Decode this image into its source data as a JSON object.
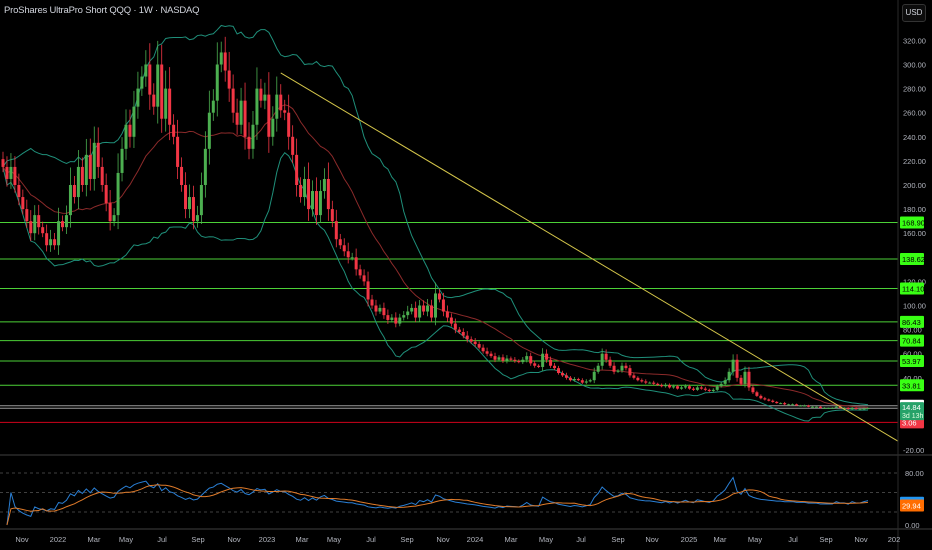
{
  "header": {
    "title": "ProShares UltraPro Short QQQ · 1W · NASDAQ",
    "currency": "USD"
  },
  "chart_data": {
    "type": "candlestick",
    "title": "ProShares UltraPro Short QQQ · 1W · NASDAQ",
    "interval": "1W",
    "price_axis": {
      "ticks": [
        "320.00",
        "300.00",
        "280.00",
        "260.00",
        "240.00",
        "220.00",
        "200.00",
        "180.00",
        "160.00",
        "120.00",
        "100.00",
        "80.00",
        "60.00",
        "40.00",
        "-20.00"
      ],
      "tick_values": [
        320,
        300,
        280,
        260,
        240,
        220,
        200,
        180,
        160,
        120,
        100,
        80,
        60,
        40,
        -20
      ],
      "range": [
        -25,
        350
      ]
    },
    "time_axis": {
      "ticks": [
        "Nov",
        "2022",
        "Mar",
        "May",
        "Jul",
        "Sep",
        "Nov",
        "2023",
        "Mar",
        "May",
        "Jul",
        "Sep",
        "Nov",
        "2024",
        "Mar",
        "May",
        "Jul",
        "Sep",
        "Nov",
        "2025",
        "Mar",
        "May",
        "Jul",
        "Sep",
        "Nov",
        "202"
      ]
    },
    "closes": [
      215,
      205,
      215,
      200,
      190,
      180,
      170,
      160,
      175,
      165,
      160,
      150,
      155,
      150,
      170,
      165,
      175,
      200,
      190,
      215,
      200,
      225,
      205,
      235,
      215,
      200,
      185,
      170,
      175,
      210,
      230,
      250,
      240,
      265,
      280,
      290,
      300,
      275,
      265,
      300,
      255,
      280,
      250,
      240,
      215,
      200,
      180,
      190,
      170,
      175,
      200,
      230,
      260,
      270,
      300,
      310,
      295,
      280,
      260,
      250,
      270,
      240,
      230,
      250,
      280,
      270,
      275,
      240,
      255,
      275,
      262,
      260,
      240,
      225,
      200,
      190,
      205,
      180,
      195,
      175,
      195,
      205,
      180,
      170,
      155,
      150,
      145,
      140,
      140,
      130,
      125,
      120,
      105,
      100,
      95,
      98,
      92,
      88,
      90,
      85,
      90,
      92,
      95,
      98,
      90,
      100,
      95,
      100,
      90,
      110,
      105,
      95,
      90,
      85,
      80,
      78,
      75,
      72,
      70,
      68,
      65,
      62,
      60,
      58,
      55,
      57,
      54,
      56,
      55,
      54,
      53,
      55,
      58,
      52,
      50,
      49,
      60,
      55,
      50,
      48,
      44,
      42,
      40,
      38,
      39,
      38,
      36,
      37,
      38,
      45,
      50,
      60,
      55,
      50,
      45,
      46,
      50,
      48,
      42,
      40,
      38,
      37,
      36,
      36,
      35,
      34,
      33,
      34,
      32,
      33,
      31,
      32,
      33,
      31,
      30,
      32,
      31,
      30,
      29,
      30,
      33,
      35,
      38,
      45,
      55,
      40,
      35,
      45,
      32,
      28,
      25,
      23,
      22,
      21,
      20,
      19,
      19,
      18,
      18,
      18,
      17,
      17,
      17,
      16,
      16,
      16,
      15,
      15,
      15,
      15,
      16,
      15,
      15,
      14,
      15,
      14,
      14,
      14.5,
      14.84
    ],
    "indicators": {
      "bollinger": {
        "period": 20,
        "stddev": 2
      },
      "rsi": {
        "period": 14,
        "signal_sma": 9
      }
    },
    "trendline": {
      "from": {
        "candle": 70,
        "price": 293
      },
      "to": {
        "candle": 212,
        "price": 14
      }
    },
    "levels": [
      {
        "label": "168.90",
        "value": 168.9,
        "color": "#4cd137",
        "bg": "#39ff14",
        "text": "#000"
      },
      {
        "label": "138.62",
        "value": 138.62,
        "color": "#4cd137",
        "bg": "#39ff14",
        "text": "#000"
      },
      {
        "label": "114.10",
        "value": 114.1,
        "color": "#4cd137",
        "bg": "#39ff14",
        "text": "#000"
      },
      {
        "label": "86.43",
        "value": 86.43,
        "color": "#4cd137",
        "bg": "#39ff14",
        "text": "#000"
      },
      {
        "label": "70.84",
        "value": 70.84,
        "color": "#4cd137",
        "bg": "#39ff14",
        "text": "#000"
      },
      {
        "label": "53.97",
        "value": 53.97,
        "color": "#4cd137",
        "bg": "#39ff14",
        "text": "#000"
      },
      {
        "label": "33.81",
        "value": 33.81,
        "color": "#4cd137",
        "bg": "#39ff14",
        "text": "#000"
      },
      {
        "label": "16.85",
        "value": 16.85,
        "color": "#9a9a9a",
        "bg": "#ffffff",
        "text": "#000"
      },
      {
        "label": "3.06",
        "value": 3.06,
        "color": "#d0021b",
        "bg": "#f23645",
        "text": "#fff"
      }
    ],
    "last_price": {
      "label": "14.84",
      "countdown": "3d 13h",
      "value": 14.84,
      "bg": "#26a269"
    },
    "rsi_axis": {
      "ticks": [
        "80.00",
        "0.00"
      ],
      "tick_values": [
        80,
        0
      ],
      "range": [
        0,
        100
      ]
    },
    "rsi_labels": [
      {
        "label": "34.18",
        "value": 34.18,
        "bg": "#2196f3"
      },
      {
        "label": "29.94",
        "value": 29.94,
        "bg": "#ff6d00"
      }
    ],
    "colors": {
      "up": "#4caf50",
      "down": "#f23645",
      "bands": "#1f8f7a",
      "basis": "#8b2a2a",
      "trendline": "#d4c54a",
      "rsi": "#2a7fd4",
      "rsi_signal": "#e07b2a"
    }
  }
}
